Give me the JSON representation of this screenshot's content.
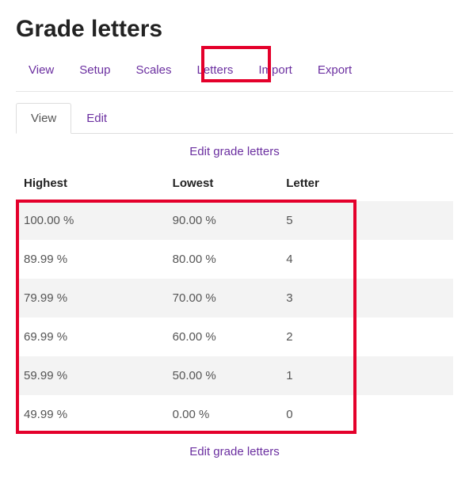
{
  "page": {
    "title": "Grade letters"
  },
  "mainTabs": {
    "items": [
      {
        "label": "View"
      },
      {
        "label": "Setup"
      },
      {
        "label": "Scales"
      },
      {
        "label": "Letters"
      },
      {
        "label": "Import"
      },
      {
        "label": "Export"
      }
    ]
  },
  "subTabs": {
    "items": [
      {
        "label": "View",
        "active": true
      },
      {
        "label": "Edit",
        "active": false
      }
    ]
  },
  "editLink": {
    "label": "Edit grade letters"
  },
  "table": {
    "headers": {
      "highest": "Highest",
      "lowest": "Lowest",
      "letter": "Letter"
    },
    "rows": [
      {
        "highest": "100.00 %",
        "lowest": "90.00 %",
        "letter": "5"
      },
      {
        "highest": "89.99 %",
        "lowest": "80.00 %",
        "letter": "4"
      },
      {
        "highest": "79.99 %",
        "lowest": "70.00 %",
        "letter": "3"
      },
      {
        "highest": "69.99 %",
        "lowest": "60.00 %",
        "letter": "2"
      },
      {
        "highest": "59.99 %",
        "lowest": "50.00 %",
        "letter": "1"
      },
      {
        "highest": "49.99 %",
        "lowest": "0.00 %",
        "letter": "0"
      }
    ]
  }
}
